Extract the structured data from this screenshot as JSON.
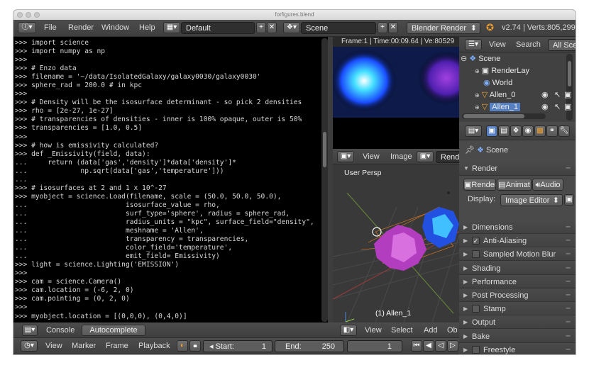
{
  "window": {
    "title": "forfigures.blend"
  },
  "info_header": {
    "menus": [
      "File",
      "Render",
      "Window",
      "Help"
    ],
    "screen_layout": "Default",
    "scene": "Scene",
    "render_engine": "Blender Render",
    "version": "v2.74 | Verts:805,299"
  },
  "console": {
    "lines": [
      ">>> import science",
      ">>> import numpy as np",
      ">>>",
      ">>> # Enzo data",
      ">>> filename = '~/data/IsolatedGalaxy/galaxy0030/galaxy0030'",
      ">>> sphere_rad = 200.0 # in kpc",
      ">>>",
      ">>> # Density will be the isosurface determinant - so pick 2 densities",
      ">>> rho = [2e-27, 1e-27]",
      ">>> # transparencies of densities - inner is 100% opaque, outer is 50%",
      ">>> transparencies = [1.0, 0.5]",
      ">>>",
      ">>> # how is emissivity calculated?",
      ">>> def _Emissivity(field, data):",
      "...     return (data['gas','density']*data['density']*",
      "...             np.sqrt(data['gas','temperature']))",
      "...",
      ">>> # isosurfaces at 2 and 1 x 10^-27",
      ">>> myobject = science.Load(filename, scale = (50.0, 50.0, 50.0),",
      "...                        isosurface_value = rho,",
      "...                        surf_type='sphere', radius = sphere_rad,",
      "...                        radius_units = \"kpc\", surface_field=\"density\",",
      "...                        meshname = 'Allen',",
      "...                        transparency = transparencies,",
      "...                        color_field='temperature',",
      "...                        emit_field= Emissivity)",
      ">>> light = science.Lighting('EMISSION')",
      ">>>",
      ">>> cam = science.Camera()",
      ">>> cam.location = (-6, 2, 0)",
      ">>> cam.pointing = (0, 2, 0)",
      ">>>",
      ">>> myobject.location = [(0,0,0), (0,4,0)]"
    ],
    "footer": {
      "console_label": "Console",
      "autocomplete_label": "Autocomplete"
    }
  },
  "timeline": {
    "menus": [
      "View",
      "Marker",
      "Frame",
      "Playback"
    ],
    "start_label": "Start:",
    "start_value": "1",
    "end_label": "End:",
    "end_value": "250",
    "current_frame": "1"
  },
  "render_view": {
    "info": "Frame:1 | Time:00:09.64 | Ve:80529"
  },
  "image_header": {
    "menus": [
      "View",
      "Image"
    ],
    "tab": "Rend"
  },
  "viewport": {
    "label": "User Persp",
    "object_label": "(1) Allen_1",
    "menus": [
      "View",
      "Select",
      "Add",
      "Ob"
    ]
  },
  "outliner": {
    "menus": [
      "View",
      "Search"
    ],
    "filter": "All Scen",
    "items": [
      {
        "name": "Scene"
      },
      {
        "name": "RenderLay"
      },
      {
        "name": "World"
      },
      {
        "name": "Allen_0"
      },
      {
        "name": "Allen_1"
      }
    ]
  },
  "properties": {
    "context": "Scene",
    "render_panel": "Render",
    "buttons": [
      "Render",
      "Animat",
      "Audio"
    ],
    "display_label": "Display:",
    "display_value": "Image Editor",
    "panels": [
      {
        "label": "Dimensions",
        "checkbox": false
      },
      {
        "label": "Anti-Aliasing",
        "checkbox": true
      },
      {
        "label": "Sampled Motion Blur",
        "checkbox": true
      },
      {
        "label": "Shading",
        "checkbox": false
      },
      {
        "label": "Performance",
        "checkbox": false
      },
      {
        "label": "Post Processing",
        "checkbox": false
      },
      {
        "label": "Stamp",
        "checkbox": true
      },
      {
        "label": "Output",
        "checkbox": false
      },
      {
        "label": "Bake",
        "checkbox": false
      },
      {
        "label": "Freestyle",
        "checkbox": true
      }
    ]
  },
  "colors": {
    "accent": "#5680c2",
    "header": "#474747",
    "console_bg": "#000000"
  }
}
